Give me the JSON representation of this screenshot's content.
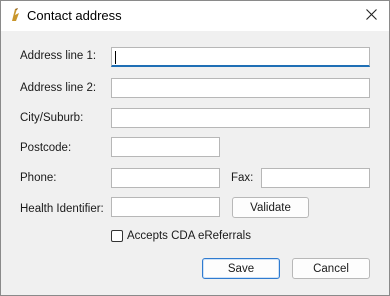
{
  "window": {
    "title": "Contact address",
    "close_icon": "close-icon"
  },
  "form": {
    "address_line1_label": "Address line 1:",
    "address_line1_value": "",
    "address_line2_label": "Address line 2:",
    "address_line2_value": "",
    "city_label": "City/Suburb:",
    "city_value": "",
    "postcode_label": "Postcode:",
    "postcode_value": "",
    "phone_label": "Phone:",
    "phone_value": "",
    "fax_label": "Fax:",
    "fax_value": "",
    "health_identifier_label": "Health Identifier:",
    "health_identifier_value": "",
    "validate_label": "Validate",
    "cda_label": "Accepts CDA eReferrals",
    "cda_checked": false
  },
  "actions": {
    "save_label": "Save",
    "cancel_label": "Cancel"
  },
  "colors": {
    "focus_accent": "#1f6fb5",
    "background": "#f0f0f0"
  }
}
